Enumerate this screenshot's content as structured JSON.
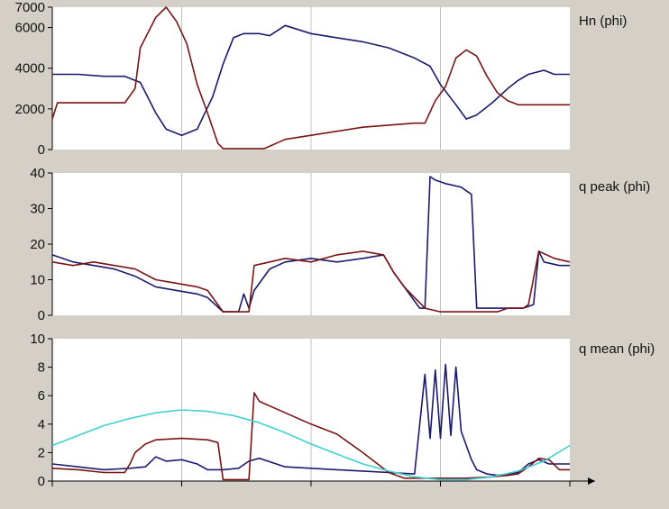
{
  "colors": {
    "background": "#d4d0c8",
    "plot_background": "#ffffff",
    "grid": "#c0c0c0",
    "axis": "#000000",
    "series_blue": "#1a1a6e",
    "series_red": "#7a1414",
    "series_cyan": "#3fd0d0"
  },
  "chart_data": [
    {
      "type": "line",
      "title": "Hn (phi)",
      "ylim": [
        0,
        7000
      ],
      "yticks": [
        "0",
        "2000",
        "4000",
        "6000",
        "7000"
      ],
      "xlim": [
        0,
        100
      ],
      "xgrid": [
        25,
        50,
        75
      ],
      "grid": true,
      "series": [
        {
          "color_key": "series_blue",
          "x": [
            0,
            5,
            10,
            14,
            17,
            20,
            22,
            25,
            28,
            31,
            33,
            35,
            37,
            40,
            42,
            45,
            50,
            55,
            60,
            65,
            70,
            73,
            75,
            78,
            80,
            82,
            85,
            88,
            90,
            92,
            95,
            97,
            100
          ],
          "y": [
            3700,
            3700,
            3600,
            3600,
            3300,
            1800,
            1000,
            700,
            1000,
            2600,
            4200,
            5500,
            5700,
            5700,
            5600,
            6100,
            5700,
            5500,
            5300,
            5000,
            4500,
            4100,
            3200,
            2200,
            1500,
            1700,
            2300,
            3000,
            3400,
            3700,
            3900,
            3700,
            3700
          ]
        },
        {
          "color_key": "series_red",
          "x": [
            0,
            1,
            3,
            8,
            14,
            16,
            17,
            20,
            22,
            24,
            26,
            28,
            30,
            32,
            33,
            35,
            38,
            41,
            45,
            50,
            55,
            60,
            65,
            70,
            72,
            74,
            76,
            78,
            80,
            82,
            84,
            86,
            88,
            90,
            95,
            100
          ],
          "y": [
            1500,
            2300,
            2300,
            2300,
            2300,
            3000,
            5000,
            6500,
            7000,
            6300,
            5200,
            3200,
            1800,
            300,
            50,
            50,
            50,
            50,
            500,
            700,
            900,
            1100,
            1200,
            1300,
            1300,
            2400,
            3100,
            4500,
            4900,
            4600,
            3600,
            2800,
            2400,
            2200,
            2200,
            2200
          ]
        }
      ]
    },
    {
      "type": "line",
      "title": "q peak (phi)",
      "ylim": [
        0,
        40
      ],
      "yticks": [
        "0",
        "10",
        "20",
        "30",
        "40"
      ],
      "xlim": [
        0,
        100
      ],
      "xgrid": [
        25,
        50,
        75
      ],
      "grid": true,
      "series": [
        {
          "color_key": "series_blue",
          "x": [
            0,
            4,
            8,
            12,
            16,
            20,
            24,
            28,
            30,
            33,
            36,
            37,
            38,
            39,
            42,
            45,
            50,
            55,
            60,
            64,
            66,
            68,
            71,
            72,
            73,
            74,
            76,
            79,
            80,
            81,
            82,
            84,
            88,
            91,
            93,
            94,
            95,
            98,
            100
          ],
          "y": [
            17,
            15,
            14,
            13,
            11,
            8,
            7,
            6,
            5,
            1,
            1,
            6,
            2,
            7,
            13,
            15,
            16,
            15,
            16,
            17,
            12,
            8,
            2,
            2,
            39,
            38,
            37,
            36,
            35,
            34,
            2,
            2,
            2,
            2,
            3,
            18,
            15,
            14,
            14
          ]
        },
        {
          "color_key": "series_red",
          "x": [
            0,
            4,
            8,
            12,
            16,
            20,
            24,
            28,
            30,
            33,
            35,
            38,
            39,
            42,
            45,
            50,
            55,
            60,
            64,
            66,
            68,
            70,
            72,
            75,
            80,
            83,
            86,
            88,
            90,
            91,
            92,
            94,
            97,
            100
          ],
          "y": [
            15,
            14,
            15,
            14,
            13,
            10,
            9,
            8,
            7,
            1,
            1,
            1,
            14,
            15,
            16,
            15,
            17,
            18,
            17,
            12,
            8,
            5,
            2,
            1,
            1,
            1,
            1,
            2,
            2,
            2,
            3,
            18,
            16,
            15
          ]
        }
      ]
    },
    {
      "type": "line",
      "title": "q mean (phi)",
      "ylim": [
        0,
        10
      ],
      "yticks": [
        "0",
        "2",
        "4",
        "6",
        "8",
        "10"
      ],
      "xlim": [
        0,
        100
      ],
      "xgrid": [
        25,
        50,
        75
      ],
      "grid": true,
      "series": [
        {
          "color_key": "series_blue",
          "x": [
            0,
            5,
            10,
            15,
            18,
            20,
            22,
            25,
            28,
            30,
            33,
            36,
            38,
            40,
            45,
            50,
            55,
            60,
            65,
            70,
            72,
            73,
            74,
            75,
            76,
            77,
            78,
            79,
            80,
            81,
            82,
            84,
            86,
            88,
            90,
            92,
            94,
            96,
            100
          ],
          "y": [
            1.2,
            1.0,
            0.8,
            0.9,
            1.0,
            1.7,
            1.4,
            1.5,
            1.2,
            0.8,
            0.8,
            0.9,
            1.4,
            1.6,
            1.0,
            0.9,
            0.8,
            0.7,
            0.6,
            0.5,
            7.5,
            3.0,
            7.8,
            3.0,
            8.2,
            3.2,
            8.0,
            3.5,
            2.5,
            1.5,
            0.8,
            0.5,
            0.4,
            0.5,
            0.6,
            1.2,
            1.5,
            1.2,
            1.2
          ]
        },
        {
          "color_key": "series_red",
          "x": [
            0,
            5,
            10,
            14,
            15,
            16,
            18,
            20,
            25,
            30,
            32,
            33,
            35,
            38,
            39,
            40,
            45,
            50,
            55,
            60,
            65,
            68,
            70,
            72,
            75,
            80,
            85,
            88,
            90,
            92,
            94,
            96,
            98,
            100
          ],
          "y": [
            0.9,
            0.8,
            0.6,
            0.6,
            1.2,
            2.0,
            2.6,
            2.9,
            3.0,
            2.9,
            2.7,
            0.1,
            0.1,
            0.1,
            6.2,
            5.6,
            4.8,
            4.0,
            3.3,
            2.0,
            0.6,
            0.2,
            0.2,
            0.2,
            0.2,
            0.2,
            0.3,
            0.4,
            0.5,
            1.0,
            1.6,
            1.5,
            0.8,
            0.8
          ]
        },
        {
          "color_key": "series_cyan",
          "x": [
            0,
            5,
            10,
            15,
            20,
            25,
            30,
            35,
            40,
            45,
            50,
            55,
            60,
            65,
            70,
            75,
            80,
            85,
            90,
            95,
            100
          ],
          "y": [
            2.5,
            3.2,
            3.9,
            4.4,
            4.8,
            5.0,
            4.9,
            4.6,
            4.1,
            3.4,
            2.6,
            1.9,
            1.2,
            0.7,
            0.3,
            0.1,
            0.1,
            0.3,
            0.7,
            1.4,
            2.5
          ]
        }
      ]
    }
  ]
}
